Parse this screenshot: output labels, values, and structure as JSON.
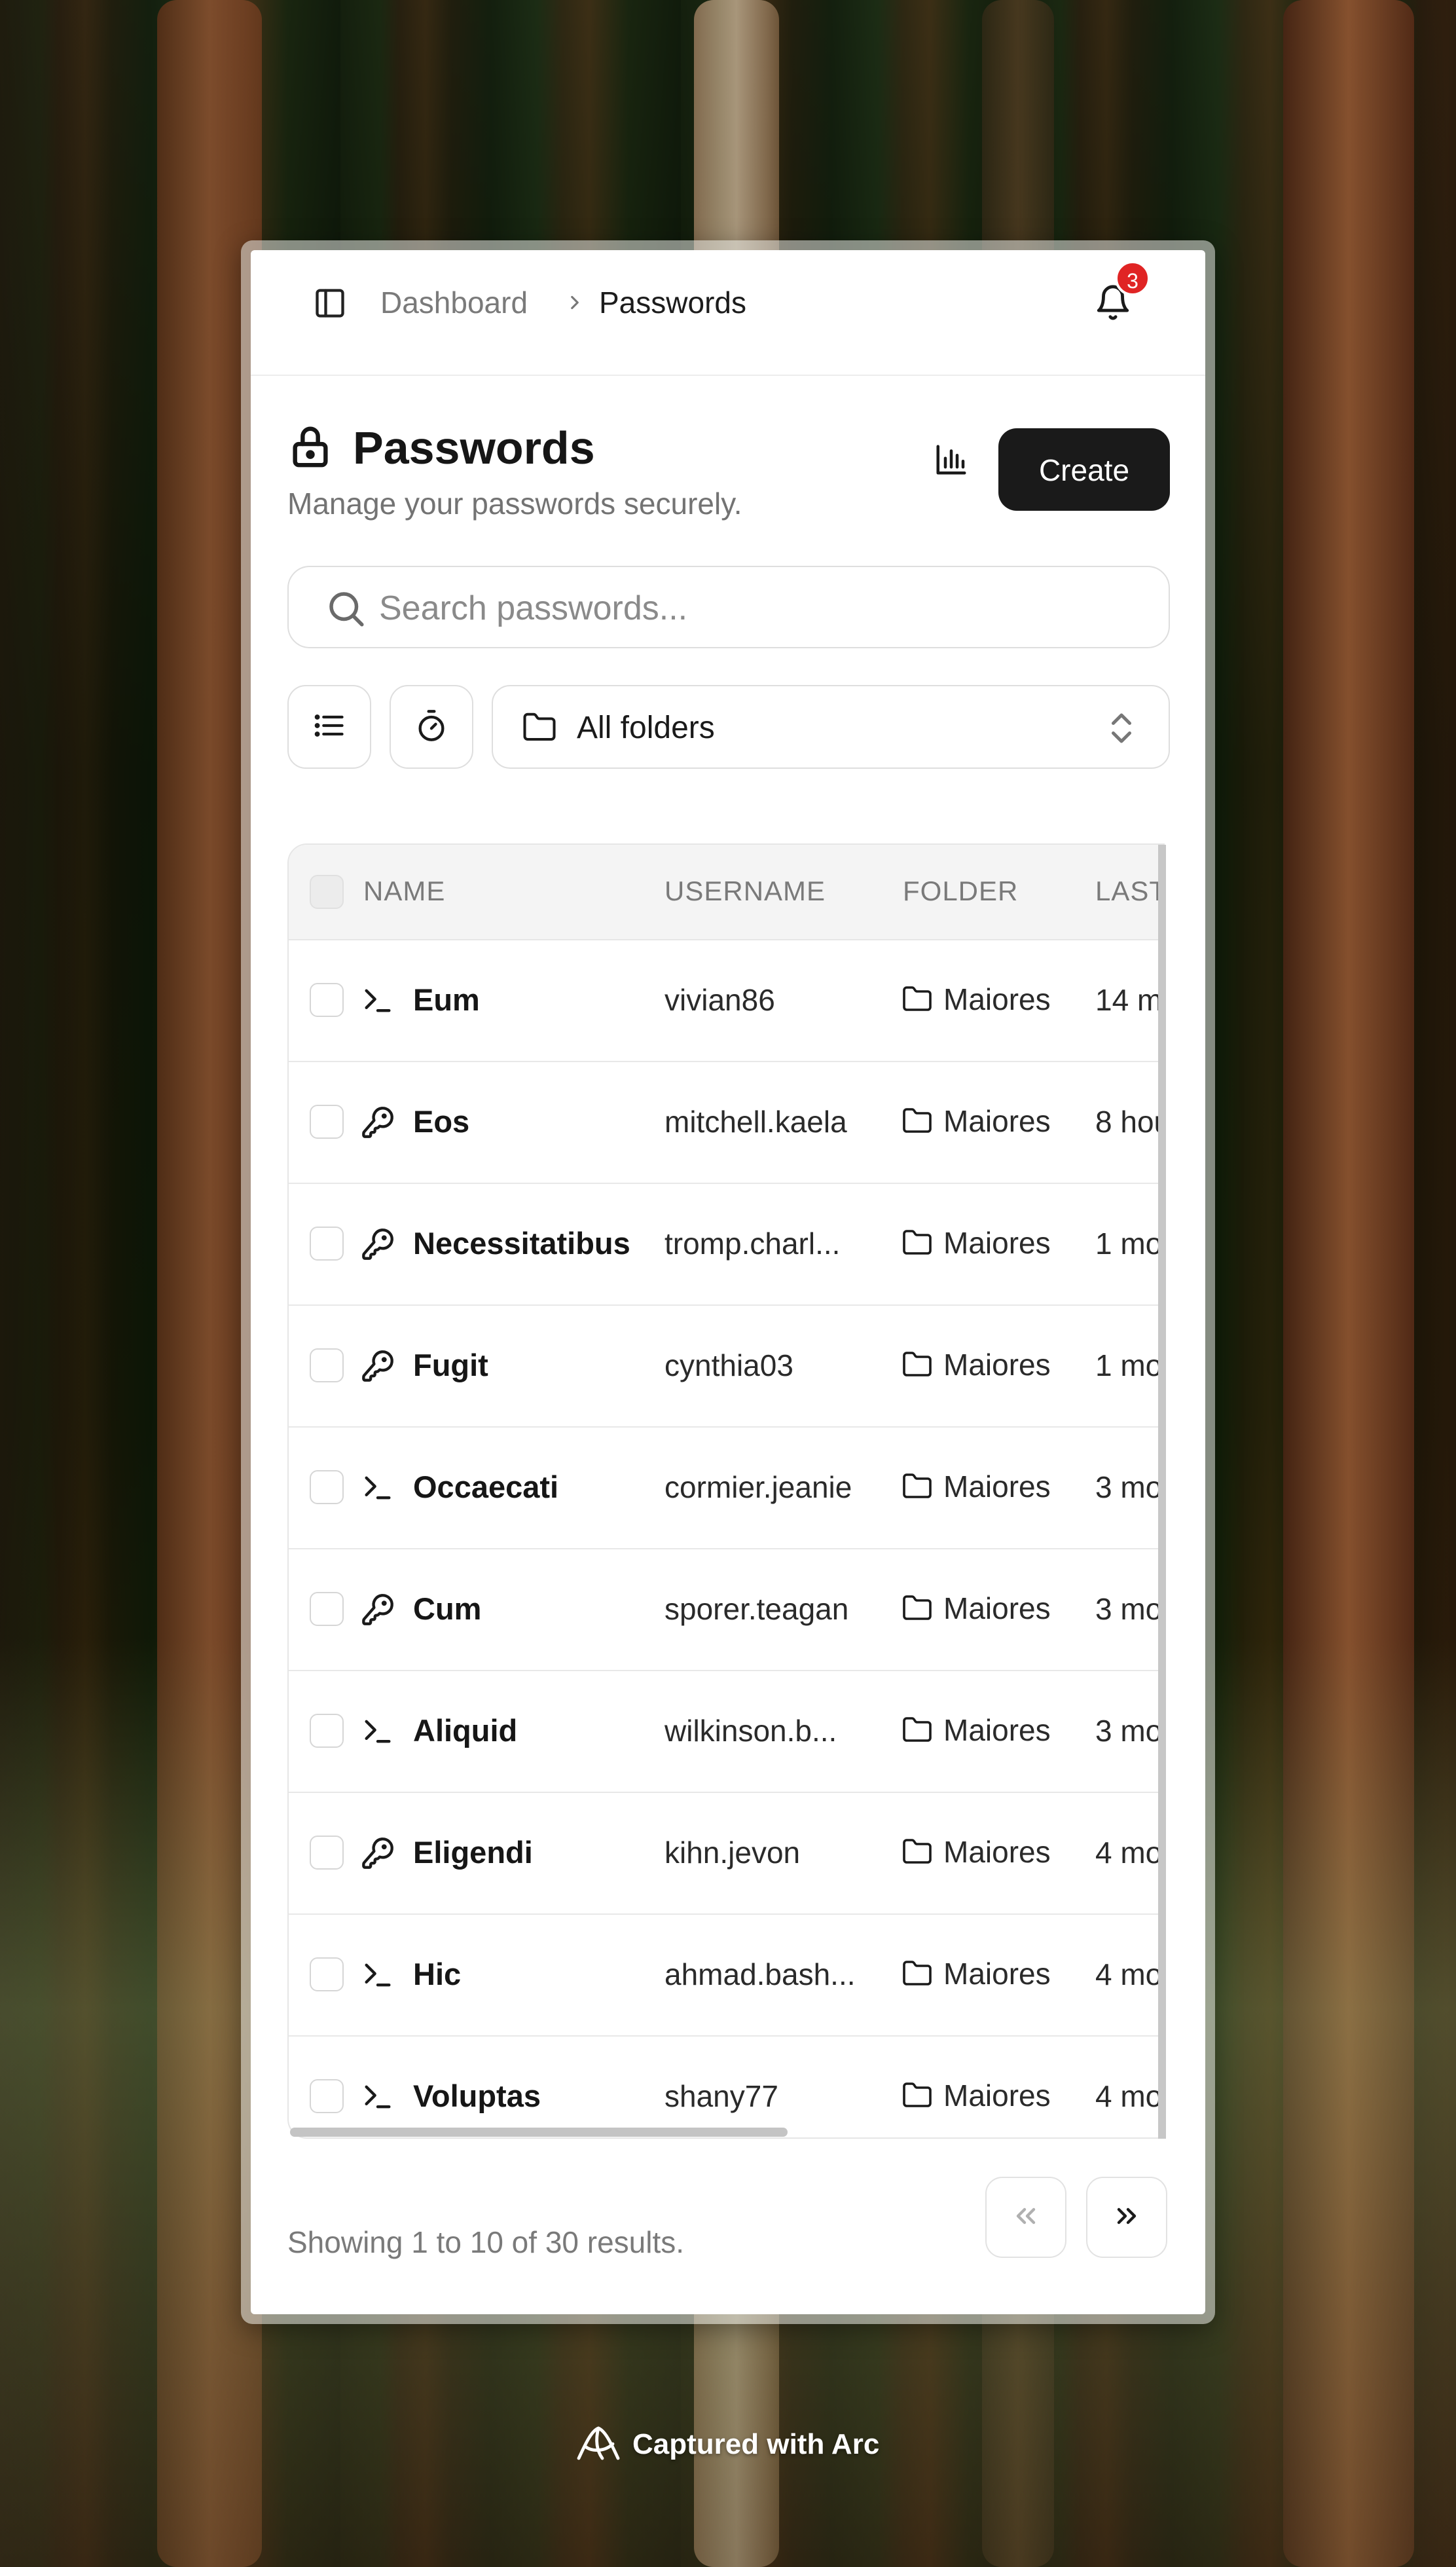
{
  "breadcrumb": {
    "home": "Dashboard",
    "current": "Passwords"
  },
  "notifications": {
    "count": "3"
  },
  "header": {
    "title": "Passwords",
    "subtitle": "Manage your passwords securely.",
    "create_label": "Create"
  },
  "search": {
    "placeholder": "Search passwords...",
    "value": ""
  },
  "filters": {
    "folder_selected": "All folders"
  },
  "table": {
    "columns": [
      "NAME",
      "USERNAME",
      "FOLDER",
      "LAST"
    ],
    "rows": [
      {
        "type": "terminal",
        "name": "Eum",
        "username": "vivian86",
        "folder": "Maiores",
        "last": "14 m"
      },
      {
        "type": "key",
        "name": "Eos",
        "username": "mitchell.kaela",
        "folder": "Maiores",
        "last": "8 hou"
      },
      {
        "type": "key",
        "name": "Necessitatibus",
        "username": "tromp.charl...",
        "folder": "Maiores",
        "last": "1 mo"
      },
      {
        "type": "key",
        "name": "Fugit",
        "username": "cynthia03",
        "folder": "Maiores",
        "last": "1 mo"
      },
      {
        "type": "terminal",
        "name": "Occaecati",
        "username": "cormier.jeanie",
        "folder": "Maiores",
        "last": "3 mo"
      },
      {
        "type": "key",
        "name": "Cum",
        "username": "sporer.teagan",
        "folder": "Maiores",
        "last": "3 mo"
      },
      {
        "type": "terminal",
        "name": "Aliquid",
        "username": "wilkinson.b...",
        "folder": "Maiores",
        "last": "3 mo"
      },
      {
        "type": "key",
        "name": "Eligendi",
        "username": "kihn.jevon",
        "folder": "Maiores",
        "last": "4 mo"
      },
      {
        "type": "terminal",
        "name": "Hic",
        "username": "ahmad.bash...",
        "folder": "Maiores",
        "last": "4 mo"
      },
      {
        "type": "terminal",
        "name": "Voluptas",
        "username": "shany77",
        "folder": "Maiores",
        "last": "4 mo"
      }
    ]
  },
  "pagination": {
    "summary": "Showing 1 to 10 of 30 results."
  },
  "footer": {
    "capture_label": "Captured with Arc"
  }
}
